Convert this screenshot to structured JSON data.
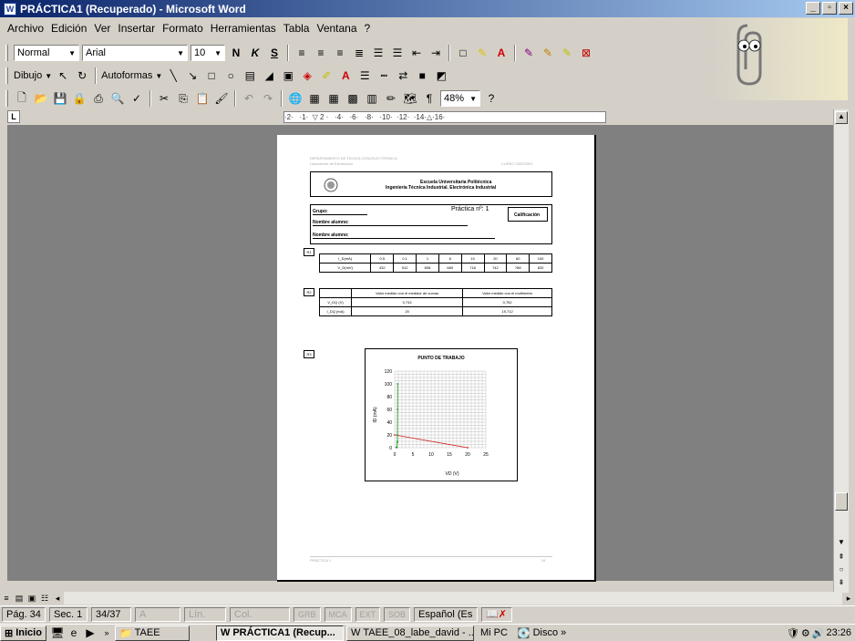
{
  "window": {
    "title": "PRÁCTICA1 (Recuperado) - Microsoft Word"
  },
  "menu": [
    "Archivo",
    "Edición",
    "Ver",
    "Insertar",
    "Formato",
    "Herramientas",
    "Tabla",
    "Ventana",
    "?"
  ],
  "format_toolbar": {
    "style": "Normal",
    "font": "Arial",
    "size": "10"
  },
  "draw_toolbar": {
    "draw_label": "Dibujo",
    "autoshapes_label": "Autoformas"
  },
  "standard_toolbar": {
    "zoom": "48%"
  },
  "ruler": {
    "ticks": "·2·   ·1·  ▽ 2 ·   ·4·   ·6·   ·8·   ·10·  ·12·  ·14·△·16·"
  },
  "document": {
    "header_left_1": "DEPARTAMENTO DE TECNOLOGÍA ELECTRÓNICA",
    "header_left_2": "Laboratorio de Electrónica",
    "header_right": "CURSO 2000/2001",
    "school_1": "Escuela Universitaria Politécnica",
    "school_2": "Ingeniería Técnica Industrial. Electrónica Industrial",
    "grupo": "Grupo:",
    "practica": "Práctica nº: 1",
    "calificacion": "Calificación",
    "alumno_1": "Nombre alumno:",
    "alumno_2": "Nombre alumno:",
    "r1_label": "R1",
    "r2_label": "R2",
    "r3_label": "R3",
    "table1": {
      "row1": [
        "I_D(mA)",
        "0.5",
        "0.1",
        "1",
        "8",
        "10",
        "20",
        "60",
        "100"
      ],
      "row2": [
        "V_D(mV)",
        "432",
        "512",
        "608",
        "680",
        "718",
        "742",
        "788",
        "820"
      ]
    },
    "table2": {
      "header": [
        "",
        "Valor medido con el medidor de curvas",
        "Valor medido con el multímetro"
      ],
      "row1": [
        "V_DQ (V)",
        "0,742",
        "0,752"
      ],
      "row2": [
        "I_DQ (mA)",
        "20",
        "19,712"
      ]
    },
    "chart_title": "PUNTO DE TRABAJO",
    "footer_left": "PRÁCTICA 1",
    "footer_right": "34"
  },
  "chart_data": {
    "type": "line",
    "title": "PUNTO DE TRABAJO",
    "xlabel": "VD (V)",
    "ylabel": "ID (mA)",
    "xlim": [
      0,
      25
    ],
    "ylim": [
      0,
      120
    ],
    "x_ticks": [
      "0",
      "5",
      "10",
      "15",
      "20",
      "25"
    ],
    "y_ticks": [
      "0",
      "20",
      "40",
      "60",
      "80",
      "100",
      "120"
    ],
    "series": [
      {
        "x": [
          0,
          20
        ],
        "y": [
          20,
          0
        ],
        "color": "#d02020"
      },
      {
        "x": [
          0.43,
          0.51,
          0.61,
          0.68,
          0.72,
          0.74,
          0.79,
          0.82
        ],
        "y": [
          0.5,
          0.1,
          1,
          8,
          10,
          20,
          60,
          100
        ],
        "color": "#20a020"
      }
    ]
  },
  "statusbar": {
    "page": "Pág. 34",
    "sec": "Sec. 1",
    "of": "34/37",
    "a": "A",
    "lin": "Lín.",
    "col": "Col.",
    "grb": "GRB",
    "mca": "MCA",
    "ext": "EXT",
    "sob": "SOB",
    "lang": "Español (Es"
  },
  "taskbar": {
    "start": "Inicio",
    "taee": "TAEE",
    "word1": "PRÁCTICA1 (Recup...",
    "word2": "TAEE_08_labe_david - ...",
    "mipc": "Mi PC",
    "disco": "Disco",
    "clock": "23:26"
  },
  "colors": {
    "title_start": "#0a246a",
    "title_end": "#a6caf0",
    "workspace": "#808080"
  }
}
